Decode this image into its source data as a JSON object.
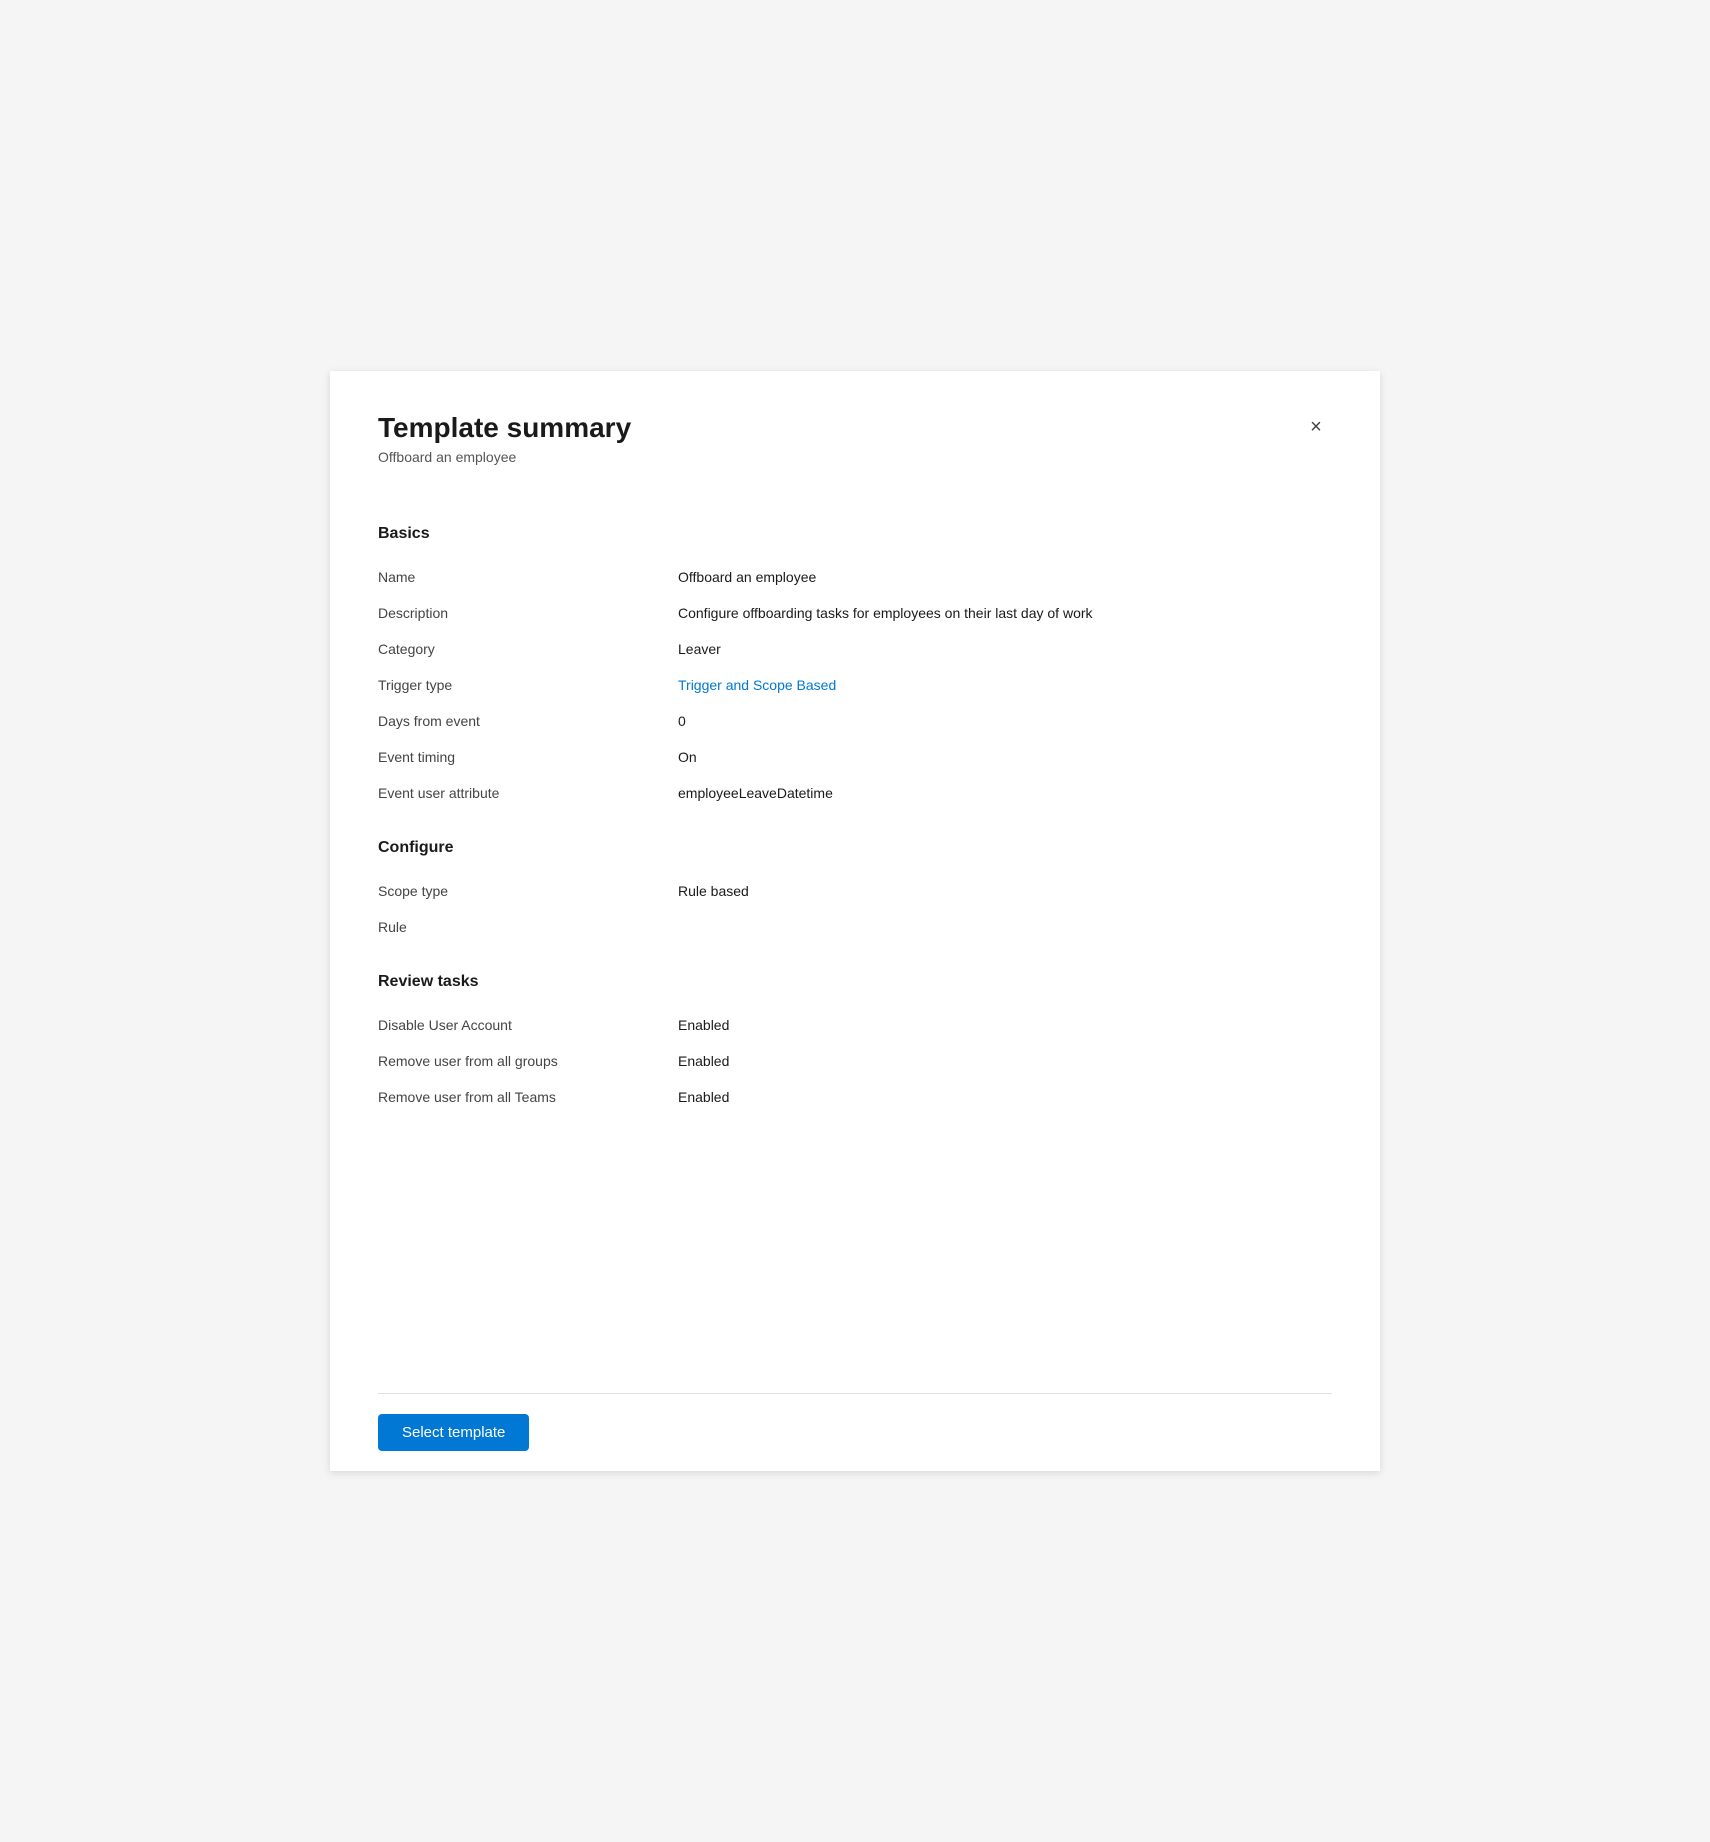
{
  "panel": {
    "title": "Template summary",
    "subtitle": "Offboard an employee",
    "close_label": "×"
  },
  "basics": {
    "section_title": "Basics",
    "fields": [
      {
        "label": "Name",
        "value": "Offboard an employee",
        "link": false
      },
      {
        "label": "Description",
        "value": "Configure offboarding tasks for employees on their last day of work",
        "link": false
      },
      {
        "label": "Category",
        "value": "Leaver",
        "link": false
      },
      {
        "label": "Trigger type",
        "value": "Trigger and Scope Based",
        "link": true
      },
      {
        "label": "Days from event",
        "value": "0",
        "link": false
      },
      {
        "label": "Event timing",
        "value": "On",
        "link": false
      },
      {
        "label": "Event user attribute",
        "value": "employeeLeaveDatetime",
        "link": false
      }
    ]
  },
  "configure": {
    "section_title": "Configure",
    "fields": [
      {
        "label": "Scope type",
        "value": "Rule based",
        "link": false
      },
      {
        "label": "Rule",
        "value": "",
        "link": false
      }
    ]
  },
  "review_tasks": {
    "section_title": "Review tasks",
    "fields": [
      {
        "label": "Disable User Account",
        "value": "Enabled",
        "link": true
      },
      {
        "label": "Remove user from all groups",
        "value": "Enabled",
        "link": true
      },
      {
        "label": "Remove user from all Teams",
        "value": "Enabled",
        "link": true
      }
    ]
  },
  "footer": {
    "select_template_label": "Select template"
  }
}
